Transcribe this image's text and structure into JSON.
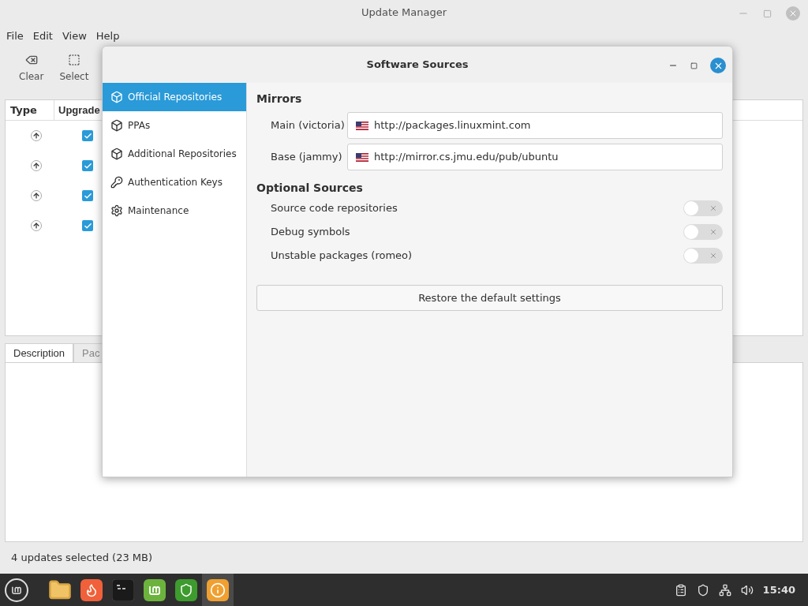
{
  "window": {
    "title": "Update Manager"
  },
  "menu": [
    "File",
    "Edit",
    "View",
    "Help"
  ],
  "toolbar": [
    {
      "label": "Clear",
      "kind": "clear"
    },
    {
      "label": "Select",
      "kind": "select"
    }
  ],
  "table": {
    "columns": [
      "Type",
      "Upgrade"
    ],
    "rows": [
      {
        "checked": true
      },
      {
        "checked": true
      },
      {
        "checked": true
      },
      {
        "checked": true
      }
    ]
  },
  "detail_tabs": [
    {
      "label": "Description",
      "selected": true
    },
    {
      "label": "Pac",
      "selected": false
    }
  ],
  "status_bar": "4 updates selected (23 MB)",
  "dialog": {
    "title": "Software Sources",
    "sidebar": [
      {
        "label": "Official Repositories",
        "kind": "box",
        "selected": true
      },
      {
        "label": "PPAs",
        "kind": "box",
        "selected": false
      },
      {
        "label": "Additional Repositories",
        "kind": "box",
        "selected": false
      },
      {
        "label": "Authentication Keys",
        "kind": "key",
        "selected": false
      },
      {
        "label": "Maintenance",
        "kind": "gear",
        "selected": false
      }
    ],
    "mirrors_title": "Mirrors",
    "mirrors": [
      {
        "label": "Main (victoria)",
        "value": "http://packages.linuxmint.com"
      },
      {
        "label": "Base (jammy)",
        "value": "http://mirror.cs.jmu.edu/pub/ubuntu"
      }
    ],
    "optional_title": "Optional Sources",
    "optional": [
      {
        "label": "Source code repositories",
        "on": false
      },
      {
        "label": "Debug symbols",
        "on": false
      },
      {
        "label": "Unstable packages (romeo)",
        "on": false
      }
    ],
    "restore_button": "Restore the default settings"
  },
  "taskbar": {
    "apps": [
      {
        "kind": "folder",
        "active": false
      },
      {
        "kind": "firefox",
        "active": false
      },
      {
        "kind": "terminal",
        "active": false
      },
      {
        "kind": "mint",
        "active": false
      },
      {
        "kind": "shield",
        "active": false
      },
      {
        "kind": "info",
        "active": true
      }
    ],
    "clock": "15:40"
  }
}
